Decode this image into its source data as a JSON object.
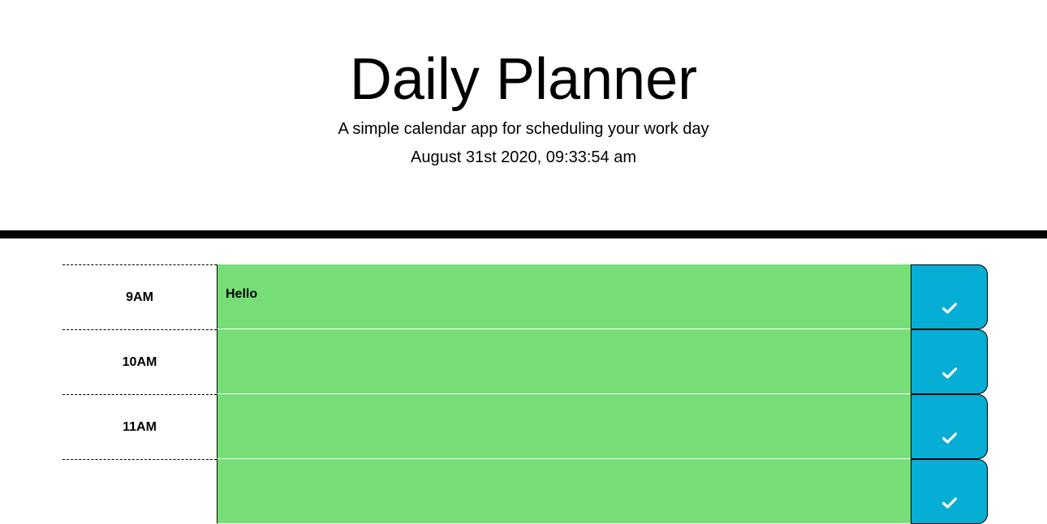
{
  "header": {
    "title": "Daily Planner",
    "subtitle": "A simple calendar app for scheduling your work day",
    "current_datetime": "August 31st 2020, 09:33:54 am"
  },
  "colors": {
    "present": "#77dd77",
    "save_button": "#06aed5",
    "divider": "#000000"
  },
  "time_blocks": [
    {
      "hour": "9AM",
      "text": "Hello",
      "save_icon": "check-icon"
    },
    {
      "hour": "10AM",
      "text": "",
      "save_icon": "check-icon"
    },
    {
      "hour": "11AM",
      "text": "",
      "save_icon": "check-icon"
    },
    {
      "hour": "",
      "text": "",
      "save_icon": "check-icon"
    }
  ]
}
